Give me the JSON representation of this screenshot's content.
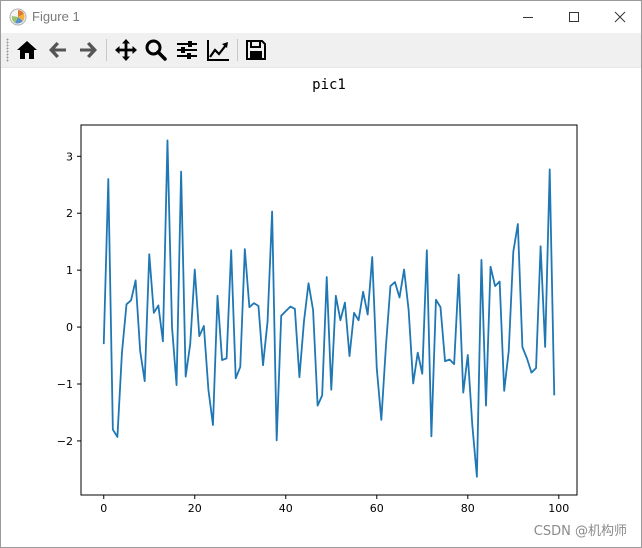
{
  "window": {
    "title": "Figure 1"
  },
  "toolbar": {
    "buttons": [
      {
        "icon": "home-icon"
      },
      {
        "icon": "back-arrow-icon"
      },
      {
        "icon": "forward-arrow-icon"
      },
      {
        "icon": "pan-icon"
      },
      {
        "icon": "zoom-icon"
      },
      {
        "icon": "subplots-config-icon"
      },
      {
        "icon": "edit-axis-icon"
      },
      {
        "icon": "save-icon"
      }
    ]
  },
  "watermark": "CSDN @机构师",
  "colors": {
    "line": "#1f77b4",
    "toolbar_bg": "#f0f0f0"
  },
  "chart_data": {
    "type": "line",
    "title": "pic1",
    "xlabel": "",
    "ylabel": "",
    "xlim": [
      -5,
      104
    ],
    "ylim": [
      -2.95,
      3.55
    ],
    "xticks": [
      0,
      20,
      40,
      60,
      80,
      100
    ],
    "yticks": [
      -2,
      -1,
      0,
      1,
      2,
      3
    ],
    "grid": false,
    "series": [
      {
        "x": [
          0,
          1,
          2,
          3,
          4,
          5,
          6,
          7,
          8,
          9,
          10,
          11,
          12,
          13,
          14,
          15,
          16,
          17,
          18,
          19,
          20,
          21,
          22,
          23,
          24,
          25,
          26,
          27,
          28,
          29,
          30,
          31,
          32,
          33,
          34,
          35,
          36,
          37,
          38,
          39,
          40,
          41,
          42,
          43,
          44,
          45,
          46,
          47,
          48,
          49,
          50,
          51,
          52,
          53,
          54,
          55,
          56,
          57,
          58,
          59,
          60,
          61,
          62,
          63,
          64,
          65,
          66,
          67,
          68,
          69,
          70,
          71,
          72,
          73,
          74,
          75,
          76,
          77,
          78,
          79,
          80,
          81,
          82,
          83,
          84,
          85,
          86,
          87,
          88,
          89,
          90,
          91,
          92,
          93,
          94,
          95,
          96,
          97,
          98,
          99
        ],
        "y": [
          -0.3,
          2.6,
          -1.8,
          -1.93,
          -0.45,
          0.4,
          0.47,
          0.82,
          -0.42,
          -0.95,
          1.28,
          0.25,
          0.38,
          -0.25,
          3.28,
          0.0,
          -1.02,
          2.73,
          -0.87,
          -0.3,
          1.01,
          -0.16,
          0.02,
          -1.1,
          -1.72,
          0.55,
          -0.58,
          -0.55,
          1.35,
          -0.9,
          -0.7,
          1.37,
          0.35,
          0.42,
          0.37,
          -0.67,
          0.1,
          2.03,
          -1.99,
          0.2,
          0.28,
          0.36,
          0.32,
          -0.88,
          0.1,
          0.77,
          0.3,
          -1.38,
          -1.2,
          0.88,
          -1.1,
          0.55,
          0.12,
          0.43,
          -0.51,
          0.25,
          0.12,
          0.62,
          0.22,
          1.23,
          -0.73,
          -1.63,
          -0.35,
          0.72,
          0.79,
          0.52,
          1.01,
          0.3,
          -0.99,
          -0.45,
          -0.82,
          1.35,
          -1.92,
          0.48,
          0.35,
          -0.6,
          -0.57,
          -0.65,
          0.92,
          -1.15,
          -0.49,
          -1.73,
          -2.63,
          1.18,
          -1.38,
          1.06,
          0.72,
          0.8,
          -1.12,
          -0.42,
          1.32,
          1.81,
          -0.35,
          -0.55,
          -0.8,
          -0.72,
          1.42,
          -0.35,
          2.77,
          -1.2
        ]
      }
    ]
  }
}
